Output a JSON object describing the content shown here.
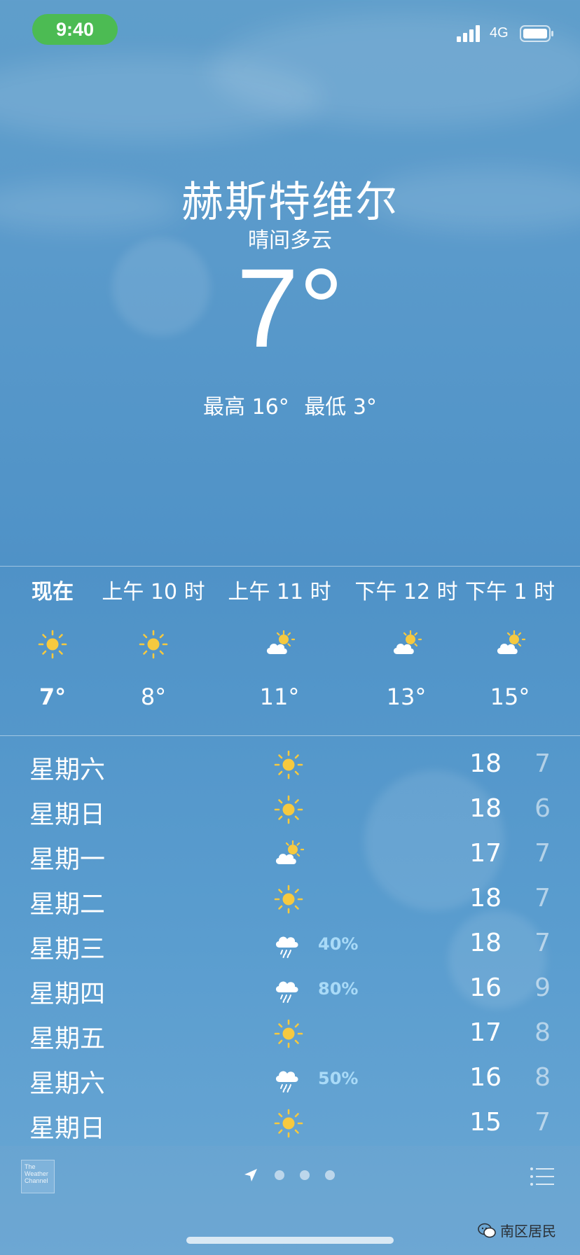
{
  "status_bar": {
    "time": "9:40",
    "network": "4G"
  },
  "header": {
    "city": "赫斯特维尔",
    "condition": "晴间多云",
    "temperature": "7°",
    "high": "最高 16°",
    "low": "最低 3°"
  },
  "hourly": [
    {
      "label": "现在",
      "temp": "7°",
      "icon": "sun-icon"
    },
    {
      "label": "上午 10 时",
      "temp": "8°",
      "icon": "sun-icon"
    },
    {
      "label": "上午 11 时",
      "temp": "11°",
      "icon": "partly-cloudy-icon"
    },
    {
      "label": "下午 12 时",
      "temp": "13°",
      "icon": "partly-cloudy-icon"
    },
    {
      "label": "下午 1 时",
      "temp": "15°",
      "icon": "partly-cloudy-icon"
    }
  ],
  "daily": [
    {
      "day": "星期六",
      "icon": "sun-icon",
      "precip": "",
      "high": "18",
      "low": "7"
    },
    {
      "day": "星期日",
      "icon": "sun-icon",
      "precip": "",
      "high": "18",
      "low": "6"
    },
    {
      "day": "星期一",
      "icon": "partly-cloudy-icon",
      "precip": "",
      "high": "17",
      "low": "7"
    },
    {
      "day": "星期二",
      "icon": "sun-icon",
      "precip": "",
      "high": "18",
      "low": "7"
    },
    {
      "day": "星期三",
      "icon": "rain-icon",
      "precip": "40%",
      "high": "18",
      "low": "7"
    },
    {
      "day": "星期四",
      "icon": "rain-icon",
      "precip": "80%",
      "high": "16",
      "low": "9"
    },
    {
      "day": "星期五",
      "icon": "sun-icon",
      "precip": "",
      "high": "17",
      "low": "8"
    },
    {
      "day": "星期六",
      "icon": "rain-icon",
      "precip": "50%",
      "high": "16",
      "low": "8"
    },
    {
      "day": "星期日",
      "icon": "sun-icon",
      "precip": "",
      "high": "15",
      "low": "7"
    }
  ],
  "footer": {
    "logo": "The Weather Channel",
    "pages": 3,
    "watermark": "南区居民"
  },
  "colors": {
    "sky": "#5a9acb",
    "sun": "#f6c93f",
    "precip": "#a9daf7",
    "time_pill": "#4cbb53"
  }
}
